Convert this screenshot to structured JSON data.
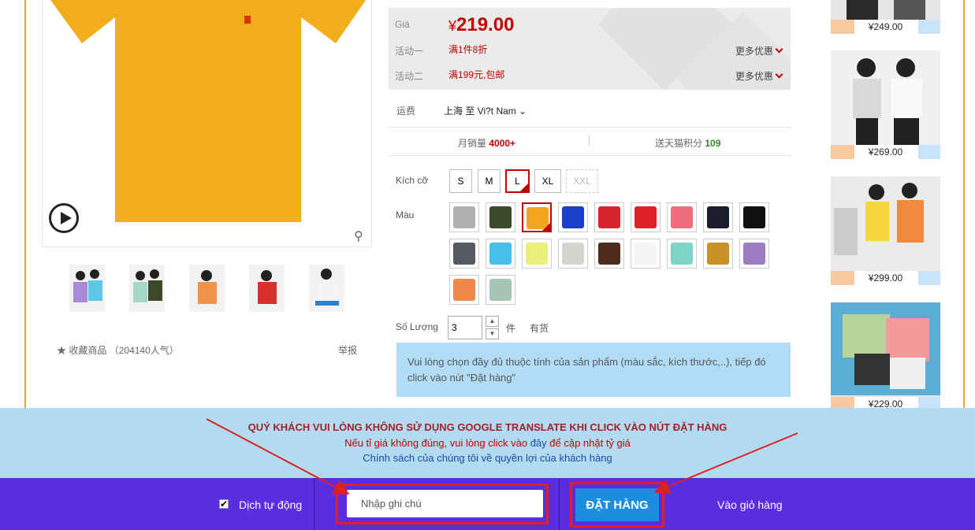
{
  "price": {
    "label": "Giá",
    "currency": "¥",
    "value": "219.00"
  },
  "promos": [
    {
      "label": "活动一",
      "text": "满1件8折",
      "more": "更多优惠"
    },
    {
      "label": "活动二",
      "text": "满199元,包邮",
      "more": "更多优惠"
    }
  ],
  "shipping": {
    "label": "运费",
    "route": "上海 至 Vi?t Nam"
  },
  "stats": {
    "sales_label": "月销量",
    "sales_value": "4000+",
    "points_label": "送天猫积分",
    "points_value": "109"
  },
  "size": {
    "label": "Kích cỡ",
    "options": [
      "S",
      "M",
      "L",
      "XL",
      "XXL"
    ],
    "selected": "L",
    "disabled": "XXL"
  },
  "color": {
    "label": "Màu",
    "swatches": [
      "#b0b0b0",
      "#3b4a2c",
      "#f2a51c",
      "#1c3fc7",
      "#d8242a",
      "#e02228",
      "#ef6e7e",
      "#1a1d2a",
      "#111111",
      "#555963",
      "#48bfe8",
      "#e9ef78",
      "#d5d5cf",
      "#4e2c1f",
      "#f5f5f5",
      "#7ed6c8",
      "#c99228",
      "#9e7cc2",
      "#f0874a",
      "#a8c4b5"
    ],
    "selected_index": 2
  },
  "quantity": {
    "label": "Số Lượng",
    "value": "3",
    "unit": "件",
    "stock": "有货"
  },
  "notice": "Vui lòng chọn đầy đủ thuộc tính của sản phẩm (màu sắc, kích thước,..), tiếp đó click vào nút \"Đặt hàng\"",
  "favorite": {
    "text": "收藏商品",
    "count": "（204140人气）",
    "report": "举报"
  },
  "sidebar": [
    {
      "price": "¥249.00"
    },
    {
      "price": "¥269.00"
    },
    {
      "price": "¥299.00"
    },
    {
      "price": "¥229.00"
    }
  ],
  "banner": {
    "warning": "QUÝ KHÁCH VUI LÒNG KHÔNG SỬ DỤNG GOOGLE TRANSLATE KHI CLICK VÀO NÚT ĐẶT HÀNG",
    "rate_before": "Nếu tỉ giá không đúng, vui lòng click vào ",
    "rate_link": "đây",
    "rate_after": " để cập nhật tỷ giá",
    "policy": "Chính sách của chúng tôi về quyền lợi của khách hàng"
  },
  "actions": {
    "auto_translate": "Dịch tự động",
    "note_placeholder": "Nhập ghi chú",
    "order": "ĐẶT HÀNG",
    "cart": "Vào giỏ hàng"
  },
  "colors": {
    "price_red": "#c40000",
    "bar_purple": "#5b2de0",
    "banner_blue": "#b2daf0",
    "button_blue": "#1c8ee0",
    "frame_orange": "#e8a33a"
  }
}
